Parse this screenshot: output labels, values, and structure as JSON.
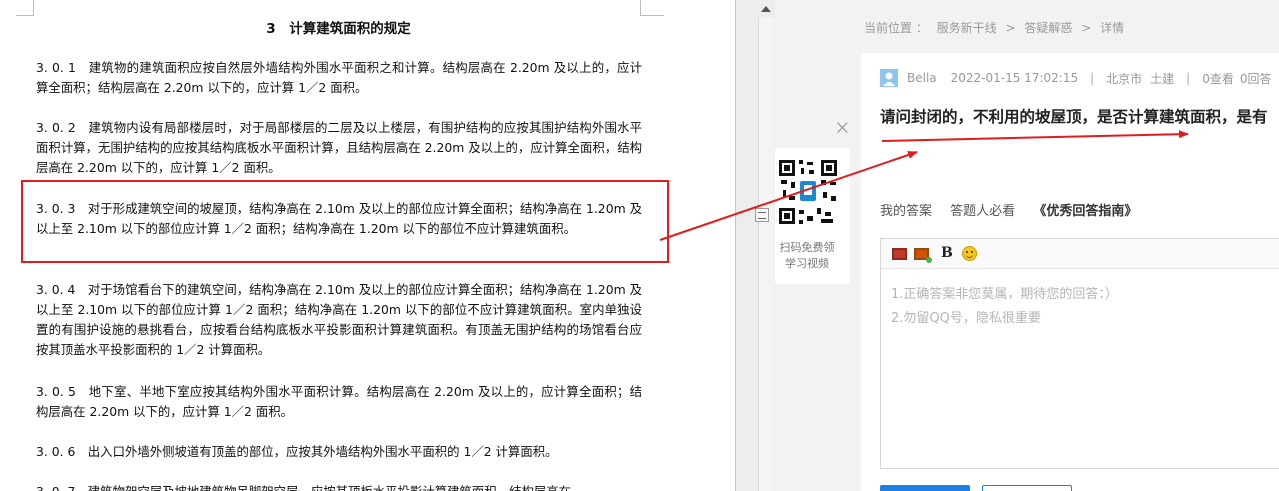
{
  "document": {
    "title": "3　计算建筑面积的规定",
    "clauses": [
      {
        "text": "3. 0. 1　建筑物的建筑面积应按自然层外墙结构外围水平面积之和计算。结构层高在 2.20m 及以上的，应计算全面积；结构层高在 2.20m 以下的，应计算 1／2 面积。"
      },
      {
        "text": "3. 0. 2　建筑物内设有局部楼层时，对于局部楼层的二层及以上楼层，有围护结构的应按其围护结构外围水平面积计算，无围护结构的应按其结构底板水平面积计算，且结构层高在 2.20m 及以上的，应计算全面积，结构层高在 2.20m 以下的，应计算 1／2 面积。"
      },
      {
        "text": "3. 0. 3　对于形成建筑空间的坡屋顶，结构净高在 2.10m 及以上的部位应计算全面积；结构净高在 1.20m 及以上至 2.10m 以下的部位应计算 1／2 面积；结构净高在 1.20m 以下的部位不应计算建筑面积。"
      },
      {
        "text": "3. 0. 4　对于场馆看台下的建筑空间，结构净高在 2.10m 及以上的部位应计算全面积；结构净高在 1.20m 及以上至 2.10m 以下的部位应计算 1／2 面积；结构净高在 1.20m 以下的部位不应计算建筑面积。室内单独设置的有围护设施的悬挑看台，应按看台结构底板水平投影面积计算建筑面积。有顶盖无围护结构的场馆看台应按其顶盖水平投影面积的 1／2 计算面积。"
      },
      {
        "text": "3. 0. 5　地下室、半地下室应按其结构外围水平面积计算。结构层高在 2.20m 及以上的，应计算全面积；结构层高在 2.20m 以下的，应计算 1／2 面积。"
      },
      {
        "text": "3. 0. 6　出入口外墙外侧坡道有顶盖的部位，应按其外墙结构外围水平面积的 1／2 计算面积。"
      },
      {
        "text": "3. 0. 7　建筑物架空层及坡地建筑物吊脚架空层，应按其顶板水平投影计算建筑面积。结构层高在"
      }
    ]
  },
  "web": {
    "breadcrumb": {
      "label": "当前位置 ：",
      "item1": "服务新干线",
      "sep1": ">",
      "item2": "答疑解惑",
      "sep2": ">",
      "item3": "详情"
    },
    "qr": {
      "close": "×",
      "caption_line1": "扫码免费领",
      "caption_line2": "学习视频"
    },
    "question": {
      "user": "Bella",
      "datetime": "2022-01-15 17:02:15",
      "sep": "|",
      "location": "北京市",
      "category": "土建",
      "views": "0查看",
      "answers": "0回答",
      "title": "请问封闭的，不利用的坡屋顶，是否计算建筑面积，是有"
    },
    "tabs": {
      "my_answer": "我的答案",
      "must_see": "答题人必看",
      "guide": "《优秀回答指南》"
    },
    "editor": {
      "bold_label": "B",
      "placeholder_line1": "1.正确答案非您莫属，期待您的回答：）",
      "placeholder_line2": "2.勿留QQ号，隐私很重要"
    }
  },
  "colors": {
    "highlight": "#e21c1c",
    "accent": "#1e7fe0"
  }
}
